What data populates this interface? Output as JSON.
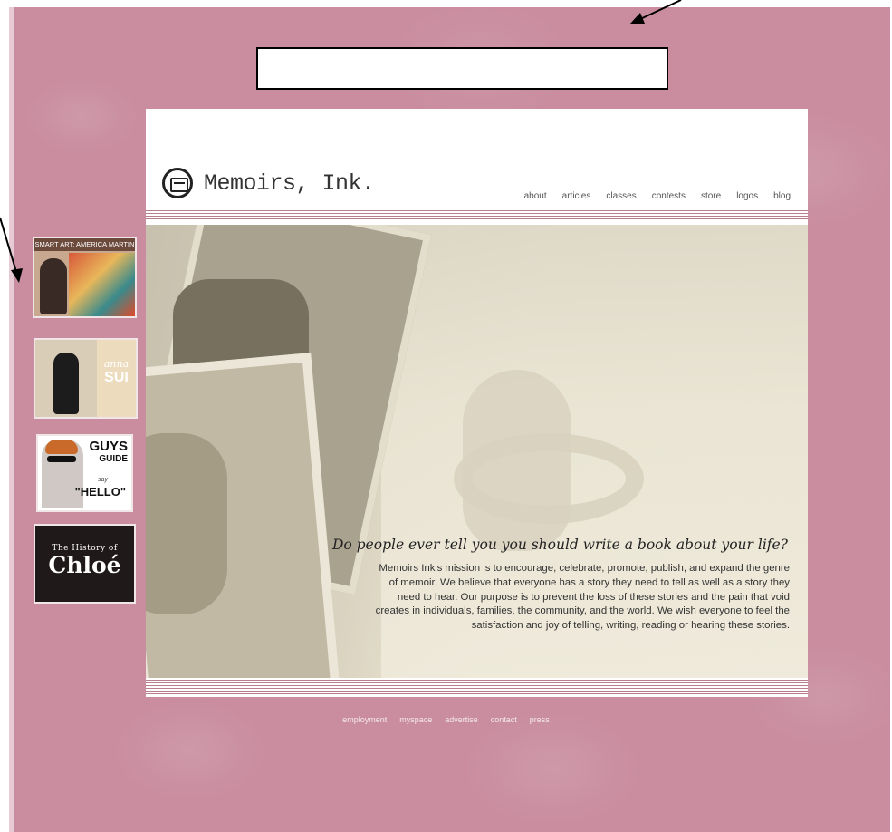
{
  "logo": {
    "text": "Memoirs, Ink."
  },
  "nav": [
    "about",
    "articles",
    "classes",
    "contests",
    "store",
    "logos",
    "blog"
  ],
  "thumbnails": [
    {
      "caption": "SMART ART: AMERICA MARTIN"
    },
    {
      "brand_line1": "anna",
      "brand_line2": "SUI"
    },
    {
      "line1": "GUYS",
      "line2": "GUIDE",
      "line3": "say",
      "line4": "\"HELLO\""
    },
    {
      "line1": "The History of",
      "line2": "Chloé"
    }
  ],
  "hero": {
    "tagline": "Do people ever tell you you should write a book about your life?",
    "mission": "Memoirs Ink's mission is to encourage, celebrate, promote, publish, and expand the genre of memoir. We believe that everyone has a story they need to tell as well as a story they need to hear. Our purpose is to prevent the loss of these stories and the pain that void creates in individuals, families, the community, and the world. We wish everyone to feel the satisfaction and joy of telling, writing, reading or hearing these stories."
  },
  "footer": [
    "employment",
    "myspace",
    "advertise",
    "contact",
    "press"
  ],
  "colors": {
    "background": "#c98d9f",
    "rule": "#b77e8e",
    "hero": "#ece8d6"
  }
}
